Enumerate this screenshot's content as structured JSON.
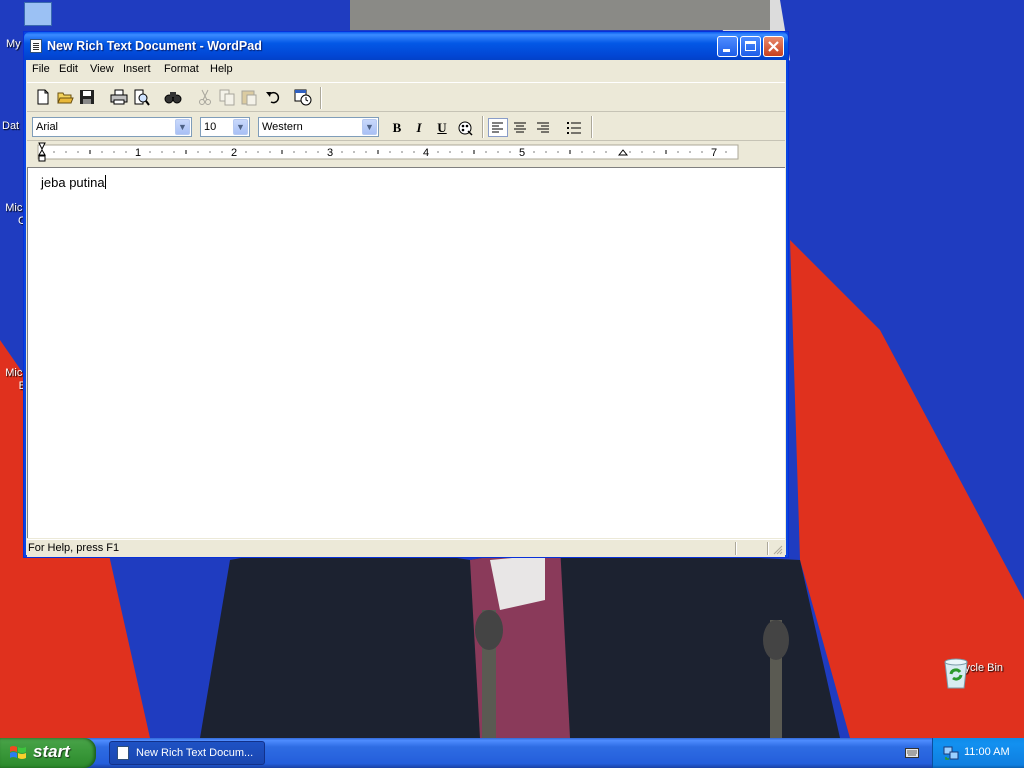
{
  "window": {
    "title": "New Rich Text Document - WordPad",
    "controls": {
      "minimize": "_",
      "maximize": "□",
      "close": "X"
    }
  },
  "menu": [
    "File",
    "Edit",
    "View",
    "Insert",
    "Format",
    "Help"
  ],
  "toolbar": {
    "icons": [
      "new-icon",
      "open-icon",
      "save-icon",
      "print-icon",
      "print-preview-icon",
      "find-icon",
      "cut-icon",
      "copy-icon",
      "paste-icon",
      "undo-icon",
      "date-time-icon"
    ]
  },
  "format_bar": {
    "font": "Arial",
    "size": "10",
    "script": "Western",
    "bold": "B",
    "italic": "I",
    "underline": "U"
  },
  "ruler": {
    "numbers": [
      "1",
      "2",
      "3",
      "4",
      "5",
      "",
      "7"
    ]
  },
  "document": {
    "text": "jeba putina"
  },
  "status": {
    "text": "For Help, press F1"
  },
  "desktop": {
    "icons": [
      {
        "label": "My"
      },
      {
        "label": "Dat"
      },
      {
        "label": "Micr C"
      },
      {
        "label": "Micr B"
      },
      {
        "label": "Recycle Bin"
      }
    ]
  },
  "taskbar": {
    "start_label": "start",
    "task_label": "New Rich Text Docum...",
    "clock": "11:00 AM"
  },
  "colors": {
    "titlebar": "#0358e6",
    "taskbar": "#245edb",
    "start": "#3c9a3c",
    "flag_blue": "#1f3cc0",
    "flag_red": "#e0311e"
  }
}
